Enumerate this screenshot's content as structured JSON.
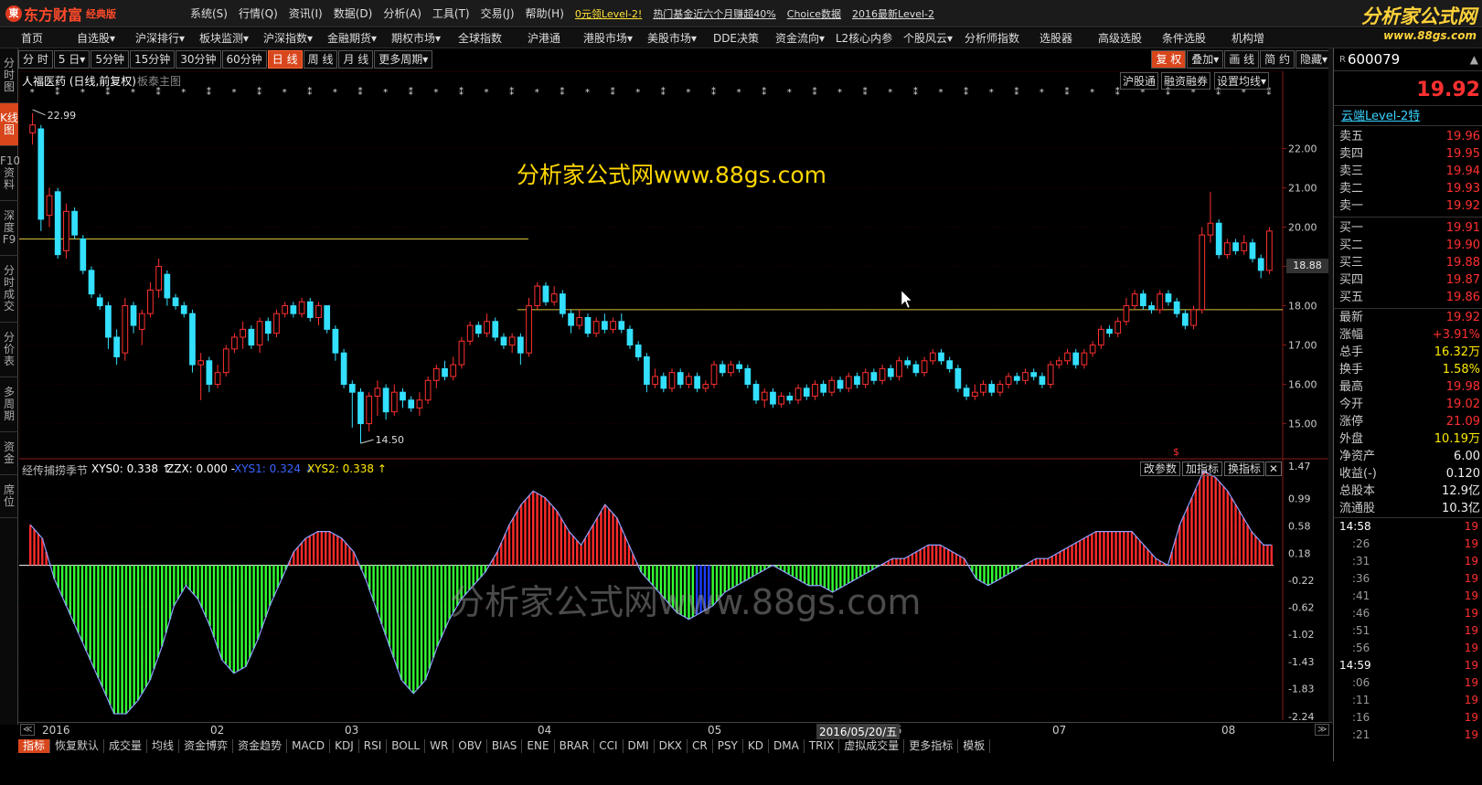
{
  "app": {
    "logo_text": "东方财富",
    "edition": "经典版",
    "menu": [
      "系统(S)",
      "行情(Q)",
      "资讯(I)",
      "数据(D)",
      "分析(A)",
      "工具(T)",
      "交易(J)",
      "帮助(H)"
    ],
    "promos": [
      "0元领Level-2!",
      "热门基金近六个月赚超40%",
      "Choice数据",
      "2016最新Level-2"
    ],
    "brand_title": "分析家公式网",
    "brand_url": "www.88gs.com"
  },
  "nav": [
    "首页",
    "自选股▾",
    "沪深排行▾",
    "板块监测▾",
    "沪深指数▾",
    "金融期货▾",
    "期权市场▾",
    "全球指数",
    "沪港通",
    "港股市场▾",
    "美股市场▾",
    "DDE决策",
    "资金流向▾",
    "L2核心内参",
    "个股风云▾",
    "分析师指数",
    "选股器",
    "高级选股",
    "条件选股",
    "机构增"
  ],
  "periods": [
    "分 时",
    "5 日▾",
    "5分钟",
    "15分钟",
    "30分钟",
    "60分钟",
    "日 线",
    "周 线",
    "月 线",
    "更多周期▾"
  ],
  "period_active_index": 6,
  "right_buttons": [
    "复 权",
    "叠加▾",
    "画 线",
    "简 约",
    "隐藏▾"
  ],
  "left_tabs": [
    "分时图",
    "K线图",
    "F10资料",
    "深度F9",
    "分时成交",
    "分价表",
    "多周期",
    "资金",
    "席位"
  ],
  "left_tab_active_index": 1,
  "chart_header": {
    "stock": "人福医药 (日线,前复权)",
    "template": "板泰主图",
    "sub_buttons": [
      "沪股通",
      "融资融券",
      "设置均线▾"
    ]
  },
  "watermark_top": "分析家公式网www.88gs.com",
  "watermark_bottom": "分析家公式网www.88gs.com",
  "indicator": {
    "name": "经传捕捞季节",
    "params": [
      {
        "label": "XYS0: 0.338 ↑",
        "color": "#ffffff"
      },
      {
        "label": "ZZX: 0.000 -",
        "color": "#ffffff"
      },
      {
        "label": "XYS1: 0.324 ↓",
        "color": "#3a64ff"
      },
      {
        "label": "XYS2: 0.338 ↑",
        "color": "#ffea00"
      }
    ],
    "buttons": [
      "改参数",
      "加指标",
      "换指标",
      "✕"
    ]
  },
  "price_axis": [
    "22.00",
    "21.00",
    "20.00",
    "19.00",
    "18.00",
    "17.00",
    "16.00",
    "15.00"
  ],
  "price_tag": "18.88",
  "ind_axis": [
    "1.47",
    "0.99",
    "0.58",
    "0.18",
    "-0.22",
    "-0.62",
    "-1.02",
    "-1.43",
    "-1.83",
    "-2.24"
  ],
  "annotations": {
    "high": "22.99",
    "low": "14.50",
    "marker": "$"
  },
  "time_axis": {
    "labels": [
      "2016",
      "02",
      "03",
      "04",
      "05",
      "06",
      "07",
      "08"
    ],
    "cursor_date": "2016/05/20/五"
  },
  "tabs": [
    "指标",
    "恢复默认",
    "成交量",
    "均线",
    "资金博弈",
    "资金趋势",
    "MACD",
    "KDJ",
    "RSI",
    "BOLL",
    "WR",
    "OBV",
    "BIAS",
    "ENE",
    "BRAR",
    "CCI",
    "DMI",
    "DKX",
    "CR",
    "PSY",
    "KD",
    "DMA",
    "TRIX",
    "虚拟成交量",
    "更多指标",
    "模板"
  ],
  "tab_active_index": 0,
  "quote": {
    "code": "600079",
    "price": "19.92",
    "source": "云端Level-2特",
    "asks": [
      {
        "label": "卖五",
        "price": "19.96"
      },
      {
        "label": "卖四",
        "price": "19.95"
      },
      {
        "label": "卖三",
        "price": "19.94"
      },
      {
        "label": "卖二",
        "price": "19.93"
      },
      {
        "label": "卖一",
        "price": "19.92"
      }
    ],
    "bids": [
      {
        "label": "买一",
        "price": "19.91"
      },
      {
        "label": "买二",
        "price": "19.90"
      },
      {
        "label": "买三",
        "price": "19.88"
      },
      {
        "label": "买四",
        "price": "19.87"
      },
      {
        "label": "买五",
        "price": "19.86"
      }
    ],
    "stats": [
      {
        "label": "最新",
        "value": "19.92",
        "color": "#ff3030"
      },
      {
        "label": "涨幅",
        "value": "+3.91%",
        "color": "#ff3030"
      },
      {
        "label": "总手",
        "value": "16.32万",
        "color": "#ffea00"
      },
      {
        "label": "换手",
        "value": "1.58%",
        "color": "#ffea00"
      },
      {
        "label": "最高",
        "value": "19.98",
        "color": "#ff3030"
      },
      {
        "label": "今开",
        "value": "19.02",
        "color": "#ff3030"
      },
      {
        "label": "涨停",
        "value": "21.09",
        "color": "#ff3030"
      },
      {
        "label": "外盘",
        "value": "10.19万",
        "color": "#ffea00"
      },
      {
        "label": "净资产",
        "value": "6.00",
        "color": "#eee"
      },
      {
        "label": "收益(-)",
        "value": "0.120",
        "color": "#eee"
      },
      {
        "label": "总股本",
        "value": "12.9亿",
        "color": "#eee"
      },
      {
        "label": "流通股",
        "value": "10.3亿",
        "color": "#eee"
      }
    ],
    "ticks1_time": "14:58",
    "ticks1": [
      ":26",
      ":31",
      ":36",
      ":41",
      ":46",
      ":51",
      ":56"
    ],
    "ticks2_time": "14:59",
    "ticks2": [
      ":06",
      ":11",
      ":16",
      ":21"
    ],
    "tick_price": "19"
  },
  "chart_data": {
    "type": "candlestick",
    "title": "人福医药 (日线,前复权)",
    "price_range": [
      14.2,
      23.5
    ],
    "high": 22.99,
    "low": 14.5,
    "horizontal_lines": [
      19.7,
      17.9
    ],
    "candles": [
      [
        22.4,
        22.6,
        22.1,
        22.9
      ],
      [
        22.5,
        20.2,
        19.9,
        22.6
      ],
      [
        20.3,
        20.8,
        20.0,
        21.0
      ],
      [
        20.9,
        19.3,
        19.2,
        21.0
      ],
      [
        19.4,
        20.4,
        19.2,
        20.6
      ],
      [
        20.4,
        19.8,
        19.7,
        20.5
      ],
      [
        19.7,
        18.9,
        18.8,
        19.8
      ],
      [
        18.9,
        18.3,
        18.2,
        19.0
      ],
      [
        18.2,
        18.0,
        17.9,
        18.3
      ],
      [
        18.0,
        17.2,
        16.9,
        18.1
      ],
      [
        17.2,
        16.7,
        16.5,
        17.4
      ],
      [
        16.8,
        18.0,
        16.6,
        18.2
      ],
      [
        18.0,
        17.5,
        17.3,
        18.1
      ],
      [
        17.4,
        17.8,
        17.0,
        17.9
      ],
      [
        17.8,
        18.4,
        17.7,
        18.6
      ],
      [
        18.4,
        19.0,
        18.2,
        19.2
      ],
      [
        18.8,
        18.2,
        18.0,
        18.9
      ],
      [
        18.2,
        18.0,
        17.9,
        18.3
      ],
      [
        18.0,
        17.8,
        17.7,
        18.1
      ],
      [
        17.8,
        16.5,
        16.3,
        17.9
      ],
      [
        16.5,
        16.6,
        15.6,
        16.8
      ],
      [
        16.6,
        16.0,
        15.8,
        16.7
      ],
      [
        16.0,
        16.3,
        15.9,
        16.5
      ],
      [
        16.3,
        16.9,
        16.2,
        17.0
      ],
      [
        16.9,
        17.2,
        16.8,
        17.3
      ],
      [
        17.2,
        17.4,
        16.9,
        17.6
      ],
      [
        17.4,
        17.0,
        16.9,
        17.5
      ],
      [
        17.0,
        17.6,
        16.8,
        17.7
      ],
      [
        17.6,
        17.3,
        17.1,
        17.7
      ],
      [
        17.3,
        17.8,
        17.2,
        17.9
      ],
      [
        17.8,
        18.0,
        17.7,
        18.1
      ],
      [
        18.0,
        17.8,
        17.7,
        18.1
      ],
      [
        17.8,
        18.1,
        17.7,
        18.2
      ],
      [
        18.1,
        17.7,
        17.6,
        18.2
      ],
      [
        17.7,
        18.0,
        17.5,
        18.1
      ],
      [
        18.0,
        17.4,
        17.3,
        18.0
      ],
      [
        17.4,
        16.8,
        16.6,
        17.5
      ],
      [
        16.8,
        16.0,
        15.9,
        16.9
      ],
      [
        16.0,
        15.8,
        14.9,
        16.1
      ],
      [
        15.8,
        15.0,
        14.5,
        15.9
      ],
      [
        15.0,
        15.7,
        14.8,
        15.8
      ],
      [
        15.7,
        15.9,
        15.2,
        16.1
      ],
      [
        15.9,
        15.3,
        15.1,
        16.0
      ],
      [
        15.3,
        15.8,
        15.2,
        16.0
      ],
      [
        15.8,
        15.6,
        15.4,
        15.9
      ],
      [
        15.6,
        15.4,
        15.3,
        15.7
      ],
      [
        15.4,
        15.6,
        15.2,
        15.8
      ],
      [
        15.6,
        16.1,
        15.5,
        16.2
      ],
      [
        16.1,
        16.4,
        15.9,
        16.5
      ],
      [
        16.4,
        16.2,
        16.1,
        16.6
      ],
      [
        16.2,
        16.5,
        16.1,
        16.7
      ],
      [
        16.5,
        17.1,
        16.4,
        17.2
      ],
      [
        17.1,
        17.5,
        17.0,
        17.6
      ],
      [
        17.5,
        17.3,
        17.2,
        17.6
      ],
      [
        17.3,
        17.6,
        17.2,
        17.8
      ],
      [
        17.6,
        17.2,
        17.1,
        17.7
      ],
      [
        17.2,
        17.0,
        16.9,
        17.3
      ],
      [
        17.0,
        17.2,
        16.8,
        17.3
      ],
      [
        17.2,
        16.8,
        16.5,
        17.3
      ],
      [
        16.8,
        18.0,
        16.7,
        18.2
      ],
      [
        18.0,
        18.5,
        17.9,
        18.6
      ],
      [
        18.5,
        18.1,
        18.0,
        18.6
      ],
      [
        18.1,
        18.3,
        18.0,
        18.5
      ],
      [
        18.3,
        17.8,
        17.7,
        18.4
      ],
      [
        17.8,
        17.5,
        17.3,
        17.9
      ],
      [
        17.5,
        17.7,
        17.4,
        17.9
      ],
      [
        17.7,
        17.3,
        17.2,
        17.8
      ],
      [
        17.3,
        17.6,
        17.2,
        17.7
      ],
      [
        17.6,
        17.4,
        17.3,
        17.8
      ],
      [
        17.4,
        17.6,
        17.3,
        17.7
      ],
      [
        17.6,
        17.4,
        17.3,
        17.8
      ],
      [
        17.4,
        17.0,
        16.9,
        17.5
      ],
      [
        17.0,
        16.7,
        16.6,
        17.1
      ],
      [
        16.7,
        16.0,
        15.8,
        16.8
      ],
      [
        16.0,
        16.2,
        15.9,
        16.4
      ],
      [
        16.2,
        15.9,
        15.8,
        16.3
      ],
      [
        15.9,
        16.3,
        15.8,
        16.4
      ],
      [
        16.3,
        16.0,
        15.9,
        16.4
      ],
      [
        16.0,
        16.2,
        15.9,
        16.3
      ],
      [
        16.2,
        15.9,
        15.8,
        16.3
      ],
      [
        15.9,
        16.0,
        15.8,
        16.1
      ],
      [
        16.0,
        16.5,
        15.9,
        16.6
      ],
      [
        16.5,
        16.3,
        16.2,
        16.6
      ],
      [
        16.3,
        16.5,
        16.2,
        16.6
      ],
      [
        16.5,
        16.4,
        16.3,
        16.6
      ],
      [
        16.4,
        16.0,
        15.9,
        16.5
      ],
      [
        16.0,
        15.6,
        15.5,
        16.1
      ],
      [
        15.6,
        15.8,
        15.4,
        15.9
      ],
      [
        15.8,
        15.5,
        15.4,
        15.9
      ],
      [
        15.5,
        15.7,
        15.4,
        15.8
      ],
      [
        15.7,
        15.6,
        15.5,
        15.8
      ],
      [
        15.6,
        15.9,
        15.5,
        16.0
      ],
      [
        15.9,
        15.7,
        15.6,
        16.0
      ],
      [
        15.7,
        16.0,
        15.6,
        16.1
      ],
      [
        16.0,
        15.8,
        15.7,
        16.1
      ],
      [
        15.8,
        16.1,
        15.7,
        16.2
      ],
      [
        16.1,
        15.9,
        15.8,
        16.2
      ],
      [
        15.9,
        16.2,
        15.8,
        16.3
      ],
      [
        16.2,
        16.0,
        15.9,
        16.3
      ],
      [
        16.0,
        16.3,
        15.9,
        16.4
      ],
      [
        16.3,
        16.1,
        16.0,
        16.4
      ],
      [
        16.1,
        16.4,
        16.0,
        16.5
      ],
      [
        16.4,
        16.2,
        16.1,
        16.5
      ],
      [
        16.2,
        16.6,
        16.1,
        16.7
      ],
      [
        16.6,
        16.5,
        16.4,
        16.7
      ],
      [
        16.5,
        16.3,
        16.2,
        16.6
      ],
      [
        16.3,
        16.6,
        16.2,
        16.7
      ],
      [
        16.6,
        16.8,
        16.5,
        16.9
      ],
      [
        16.8,
        16.6,
        16.5,
        16.9
      ],
      [
        16.6,
        16.4,
        16.3,
        16.7
      ],
      [
        16.4,
        15.9,
        15.8,
        16.5
      ],
      [
        15.9,
        15.7,
        15.6,
        16.0
      ],
      [
        15.7,
        15.8,
        15.6,
        16.0
      ],
      [
        15.8,
        16.0,
        15.7,
        16.1
      ],
      [
        16.0,
        15.8,
        15.7,
        16.1
      ],
      [
        15.8,
        16.0,
        15.7,
        16.1
      ],
      [
        16.0,
        16.2,
        15.9,
        16.3
      ],
      [
        16.2,
        16.1,
        16.0,
        16.3
      ],
      [
        16.1,
        16.3,
        16.0,
        16.4
      ],
      [
        16.3,
        16.2,
        16.1,
        16.4
      ],
      [
        16.2,
        16.0,
        15.9,
        16.3
      ],
      [
        16.0,
        16.5,
        15.9,
        16.6
      ],
      [
        16.5,
        16.6,
        16.4,
        16.7
      ],
      [
        16.6,
        16.8,
        16.5,
        16.9
      ],
      [
        16.8,
        16.5,
        16.4,
        16.9
      ],
      [
        16.5,
        16.8,
        16.4,
        16.9
      ],
      [
        16.8,
        17.0,
        16.7,
        17.1
      ],
      [
        17.0,
        17.4,
        16.9,
        17.5
      ],
      [
        17.4,
        17.3,
        17.2,
        17.5
      ],
      [
        17.3,
        17.6,
        17.2,
        17.7
      ],
      [
        17.6,
        18.0,
        17.5,
        18.2
      ],
      [
        18.0,
        18.3,
        17.9,
        18.4
      ],
      [
        18.3,
        18.0,
        17.9,
        18.4
      ],
      [
        18.0,
        17.9,
        17.8,
        18.1
      ],
      [
        17.9,
        18.3,
        17.8,
        18.4
      ],
      [
        18.3,
        18.1,
        18.0,
        18.4
      ],
      [
        18.1,
        17.8,
        17.7,
        18.2
      ],
      [
        17.8,
        17.5,
        17.4,
        17.9
      ],
      [
        17.5,
        17.9,
        17.4,
        18.0
      ],
      [
        17.9,
        19.8,
        17.8,
        20.0
      ],
      [
        19.8,
        20.1,
        19.6,
        20.9
      ],
      [
        20.1,
        19.3,
        19.2,
        20.2
      ],
      [
        19.3,
        19.6,
        19.2,
        19.7
      ],
      [
        19.6,
        19.4,
        19.3,
        19.7
      ],
      [
        19.4,
        19.6,
        19.3,
        19.8
      ],
      [
        19.6,
        19.2,
        19.1,
        19.7
      ],
      [
        19.2,
        18.9,
        18.7,
        19.3
      ],
      [
        18.9,
        19.9,
        18.8,
        20.0
      ]
    ],
    "indicator_series": [
      0.6,
      0.4,
      -0.2,
      -0.6,
      -1.0,
      -1.4,
      -1.8,
      -2.2,
      -2.2,
      -2.0,
      -1.7,
      -1.2,
      -0.6,
      -0.3,
      -0.5,
      -0.9,
      -1.4,
      -1.6,
      -1.5,
      -1.1,
      -0.6,
      -0.2,
      0.2,
      0.4,
      0.5,
      0.5,
      0.4,
      0.2,
      -0.2,
      -0.7,
      -1.2,
      -1.7,
      -1.9,
      -1.7,
      -1.2,
      -0.8,
      -0.5,
      -0.3,
      -0.1,
      0.2,
      0.6,
      0.9,
      1.1,
      1.0,
      0.8,
      0.5,
      0.3,
      0.6,
      0.9,
      0.7,
      0.3,
      -0.1,
      -0.3,
      -0.5,
      -0.7,
      -0.8,
      -0.7,
      -0.6,
      -0.4,
      -0.3,
      -0.2,
      -0.1,
      0.0,
      -0.1,
      -0.2,
      -0.3,
      -0.3,
      -0.4,
      -0.3,
      -0.2,
      -0.1,
      0.0,
      0.1,
      0.1,
      0.2,
      0.3,
      0.3,
      0.2,
      0.1,
      -0.2,
      -0.3,
      -0.2,
      -0.1,
      0.0,
      0.1,
      0.1,
      0.2,
      0.3,
      0.4,
      0.5,
      0.5,
      0.5,
      0.5,
      0.3,
      0.1,
      0.0,
      0.6,
      1.0,
      1.4,
      1.3,
      1.1,
      0.8,
      0.5,
      0.3
    ]
  }
}
